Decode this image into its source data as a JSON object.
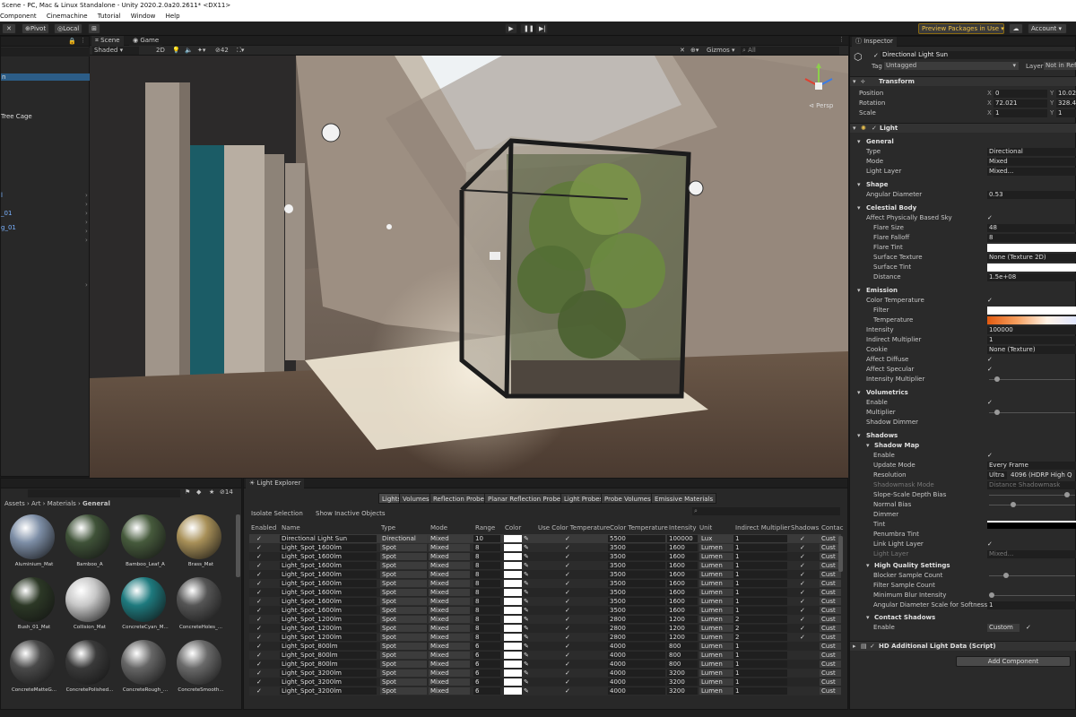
{
  "window": {
    "title": "Scene - PC, Mac & Linux Standalone - Unity 2020.2.0a20.2611* <DX11>"
  },
  "menu": [
    "Component",
    "Cinemachine",
    "Tutorial",
    "Window",
    "Help"
  ],
  "toolbar": {
    "pivot": "Pivot",
    "local": "Local",
    "preview_packages": "Preview Packages in Use",
    "account": "Account"
  },
  "hierarchy": {
    "items": [
      "n",
      "Tree Cage",
      "l",
      "_01",
      "g_01"
    ]
  },
  "scene": {
    "tabs": [
      "Scene",
      "Game"
    ],
    "shading": "Shaded",
    "mode_2d": "2D",
    "hidden_count": "42",
    "gizmos": "Gizmos",
    "search_all": "All",
    "persp": "Persp"
  },
  "inspector": {
    "tab": "Inspector",
    "object_name": "Directional Light Sun",
    "tag_label": "Tag",
    "tag": "Untagged",
    "layer_label": "Layer",
    "layer": "Not in Refle",
    "transform": {
      "title": "Transform",
      "position": {
        "label": "Position",
        "x": "0",
        "y": "10.02"
      },
      "rotation": {
        "label": "Rotation",
        "x": "72.021",
        "y": "328.46"
      },
      "scale": {
        "label": "Scale",
        "x": "1",
        "y": "1"
      }
    },
    "light_title": "Light",
    "general": {
      "title": "General",
      "type_label": "Type",
      "type": "Directional",
      "mode_label": "Mode",
      "mode": "Mixed",
      "layer_label": "Light Layer",
      "layer": "Mixed..."
    },
    "shape": {
      "title": "Shape",
      "angular_label": "Angular Diameter",
      "angular": "0.53"
    },
    "celestial": {
      "title": "Celestial Body",
      "affect_sky": "Affect Physically Based Sky",
      "flare_size_label": "Flare Size",
      "flare_size": "48",
      "flare_falloff_label": "Flare Falloff",
      "flare_falloff": "8",
      "flare_tint": "Flare Tint",
      "surface_texture_label": "Surface Texture",
      "surface_texture": "None (Texture 2D)",
      "surface_tint": "Surface Tint",
      "distance_label": "Distance",
      "distance": "1.5e+08"
    },
    "emission": {
      "title": "Emission",
      "color_temp": "Color Temperature",
      "filter": "Filter",
      "temperature": "Temperature",
      "intensity_label": "Intensity",
      "intensity": "100000",
      "indirect_label": "Indirect Multiplier",
      "indirect": "1",
      "cookie_label": "Cookie",
      "cookie": "None (Texture)",
      "affect_diffuse": "Affect Diffuse",
      "affect_specular": "Affect Specular",
      "intensity_mult": "Intensity Multiplier"
    },
    "volumetrics": {
      "title": "Volumetrics",
      "enable": "Enable",
      "multiplier": "Multiplier",
      "shadow_dimmer": "Shadow Dimmer"
    },
    "shadows": {
      "title": "Shadows",
      "shadow_map": "Shadow Map",
      "enable": "Enable",
      "update_label": "Update Mode",
      "update": "Every Frame",
      "resolution_label": "Resolution",
      "resolution_preset": "Ultra",
      "resolution": "4096 (HDRP High Q",
      "shadowmask_label": "Shadowmask Mode",
      "shadowmask": "Distance Shadowmask",
      "slope_bias": "Slope-Scale Depth Bias",
      "normal_bias": "Normal Bias",
      "dimmer": "Dimmer",
      "tint": "Tint",
      "penumbra": "Penumbra Tint",
      "link_layer": "Link Light Layer",
      "light_layer_label": "Light Layer",
      "light_layer": "Mixed...",
      "hq_title": "High Quality Settings",
      "blocker": "Blocker Sample Count",
      "filter_count": "Filter Sample Count",
      "min_blur": "Minimum Blur Intensity",
      "angular_scale_label": "Angular Diameter Scale for Softness",
      "angular_scale": "1",
      "contact_title": "Contact Shadows",
      "contact_enable_label": "Enable",
      "contact_enable": "Custom"
    },
    "hd_component": "HD Additional Light Data (Script)",
    "add_component": "Add Component"
  },
  "project": {
    "breadcrumb": [
      "Assets",
      "Art",
      "Materials",
      "General"
    ],
    "count": "14",
    "materials": [
      {
        "name": "Aluminium_Mat",
        "color": "#7d8ea6"
      },
      {
        "name": "Bamboo_A",
        "color": "#3f5238"
      },
      {
        "name": "Bamboo_Leaf_A",
        "color": "#465a3c"
      },
      {
        "name": "Brass_Mat",
        "color": "#a89058"
      },
      {
        "name": "Bush_01_Mat",
        "color": "#2c3826"
      },
      {
        "name": "Collision_Mat",
        "color": "#c8c8c8"
      },
      {
        "name": "ConcreteCyan_M...",
        "color": "#1e7a7e"
      },
      {
        "name": "ConcreteHoles_...",
        "color": "#555555"
      },
      {
        "name": "ConcreteMatteG...",
        "color": "#4a4a4a"
      },
      {
        "name": "ConcretePolished...",
        "color": "#3a3a3a"
      },
      {
        "name": "ConcreteRough_...",
        "color": "#666666"
      },
      {
        "name": "ConcreteSmooth...",
        "color": "#6a6a6a"
      }
    ]
  },
  "light_explorer": {
    "tab": "Light Explorer",
    "subtabs": [
      "Lights",
      "Volumes",
      "Reflection Probes",
      "Planar Reflection Probes",
      "Light Probes",
      "Probe Volumes",
      "Emissive Materials"
    ],
    "isolate": "Isolate Selection",
    "show_inactive": "Show Inactive Objects",
    "columns": [
      "Enabled",
      "Name",
      "Type",
      "Mode",
      "Range",
      "Color",
      "Use Color Temperature",
      "Color Temperature",
      "Intensity",
      "Unit",
      "Indirect Multiplier",
      "Shadows",
      "Contac"
    ],
    "rows": [
      {
        "name": "Directional Light Sun",
        "type": "Directional",
        "mode": "Mixed",
        "range": "10",
        "temp": "5500",
        "intensity": "100000",
        "unit": "Lux",
        "indirect": "1",
        "shadows": "✓",
        "contact": "Cust"
      },
      {
        "name": "Light_Spot_1600lm",
        "type": "Spot",
        "mode": "Mixed",
        "range": "8",
        "temp": "3500",
        "intensity": "1600",
        "unit": "Lumen",
        "indirect": "1",
        "shadows": "✓",
        "contact": "Cust"
      },
      {
        "name": "Light_Spot_1600lm",
        "type": "Spot",
        "mode": "Mixed",
        "range": "8",
        "temp": "3500",
        "intensity": "1600",
        "unit": "Lumen",
        "indirect": "1",
        "shadows": "✓",
        "contact": "Cust"
      },
      {
        "name": "Light_Spot_1600lm",
        "type": "Spot",
        "mode": "Mixed",
        "range": "8",
        "temp": "3500",
        "intensity": "1600",
        "unit": "Lumen",
        "indirect": "1",
        "shadows": "✓",
        "contact": "Cust"
      },
      {
        "name": "Light_Spot_1600lm",
        "type": "Spot",
        "mode": "Mixed",
        "range": "8",
        "temp": "3500",
        "intensity": "1600",
        "unit": "Lumen",
        "indirect": "1",
        "shadows": "✓",
        "contact": "Cust"
      },
      {
        "name": "Light_Spot_1600lm",
        "type": "Spot",
        "mode": "Mixed",
        "range": "8",
        "temp": "3500",
        "intensity": "1600",
        "unit": "Lumen",
        "indirect": "1",
        "shadows": "✓",
        "contact": "Cust"
      },
      {
        "name": "Light_Spot_1600lm",
        "type": "Spot",
        "mode": "Mixed",
        "range": "8",
        "temp": "3500",
        "intensity": "1600",
        "unit": "Lumen",
        "indirect": "1",
        "shadows": "✓",
        "contact": "Cust"
      },
      {
        "name": "Light_Spot_1600lm",
        "type": "Spot",
        "mode": "Mixed",
        "range": "8",
        "temp": "3500",
        "intensity": "1600",
        "unit": "Lumen",
        "indirect": "1",
        "shadows": "✓",
        "contact": "Cust"
      },
      {
        "name": "Light_Spot_1600lm",
        "type": "Spot",
        "mode": "Mixed",
        "range": "8",
        "temp": "3500",
        "intensity": "1600",
        "unit": "Lumen",
        "indirect": "1",
        "shadows": "✓",
        "contact": "Cust"
      },
      {
        "name": "Light_Spot_1200lm",
        "type": "Spot",
        "mode": "Mixed",
        "range": "8",
        "temp": "2800",
        "intensity": "1200",
        "unit": "Lumen",
        "indirect": "2",
        "shadows": "✓",
        "contact": "Cust"
      },
      {
        "name": "Light_Spot_1200lm",
        "type": "Spot",
        "mode": "Mixed",
        "range": "8",
        "temp": "2800",
        "intensity": "1200",
        "unit": "Lumen",
        "indirect": "2",
        "shadows": "✓",
        "contact": "Cust"
      },
      {
        "name": "Light_Spot_1200lm",
        "type": "Spot",
        "mode": "Mixed",
        "range": "8",
        "temp": "2800",
        "intensity": "1200",
        "unit": "Lumen",
        "indirect": "2",
        "shadows": "✓",
        "contact": "Cust"
      },
      {
        "name": "Light_Spot_800lm",
        "type": "Spot",
        "mode": "Mixed",
        "range": "6",
        "temp": "4000",
        "intensity": "800",
        "unit": "Lumen",
        "indirect": "1",
        "shadows": "",
        "contact": "Cust"
      },
      {
        "name": "Light_Spot_800lm",
        "type": "Spot",
        "mode": "Mixed",
        "range": "6",
        "temp": "4000",
        "intensity": "800",
        "unit": "Lumen",
        "indirect": "1",
        "shadows": "",
        "contact": "Cust"
      },
      {
        "name": "Light_Spot_800lm",
        "type": "Spot",
        "mode": "Mixed",
        "range": "6",
        "temp": "4000",
        "intensity": "800",
        "unit": "Lumen",
        "indirect": "1",
        "shadows": "",
        "contact": "Cust"
      },
      {
        "name": "Light_Spot_3200lm",
        "type": "Spot",
        "mode": "Mixed",
        "range": "6",
        "temp": "4000",
        "intensity": "3200",
        "unit": "Lumen",
        "indirect": "1",
        "shadows": "",
        "contact": "Cust"
      },
      {
        "name": "Light_Spot_3200lm",
        "type": "Spot",
        "mode": "Mixed",
        "range": "6",
        "temp": "4000",
        "intensity": "3200",
        "unit": "Lumen",
        "indirect": "1",
        "shadows": "",
        "contact": "Cust"
      },
      {
        "name": "Light_Spot_3200lm",
        "type": "Spot",
        "mode": "Mixed",
        "range": "6",
        "temp": "4000",
        "intensity": "3200",
        "unit": "Lumen",
        "indirect": "1",
        "shadows": "",
        "contact": "Cust"
      }
    ]
  }
}
